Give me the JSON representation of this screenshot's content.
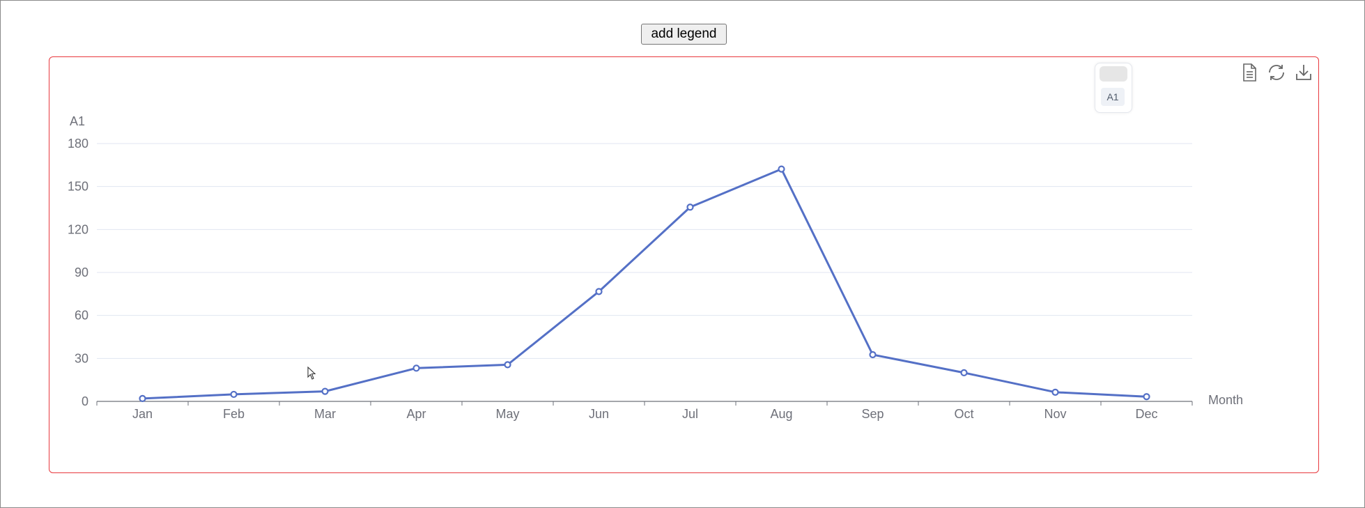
{
  "toolbar": {
    "add_legend_label": "add legend"
  },
  "legend": {
    "items": [
      {
        "label": "A1"
      }
    ]
  },
  "toolbox": {
    "icons": [
      "data-view-icon",
      "restore-icon",
      "save-as-image-icon"
    ]
  },
  "colors": {
    "series": "#5470c6",
    "frame_border": "#e8383d",
    "axis": "#6e7079",
    "grid": "#e0e6f1"
  },
  "chart_data": {
    "type": "line",
    "xlabel": "Month",
    "ylabel": "A1",
    "categories": [
      "Jan",
      "Feb",
      "Mar",
      "Apr",
      "May",
      "Jun",
      "Jul",
      "Aug",
      "Sep",
      "Oct",
      "Nov",
      "Dec"
    ],
    "y_ticks": [
      0,
      30,
      60,
      90,
      120,
      150,
      180
    ],
    "ylim": [
      0,
      180
    ],
    "grid": "horizontal",
    "series": [
      {
        "values": [
          2,
          4.9,
          7,
          23.2,
          25.6,
          76.7,
          135.6,
          162.2,
          32.6,
          20,
          6.4,
          3.3
        ]
      }
    ]
  }
}
